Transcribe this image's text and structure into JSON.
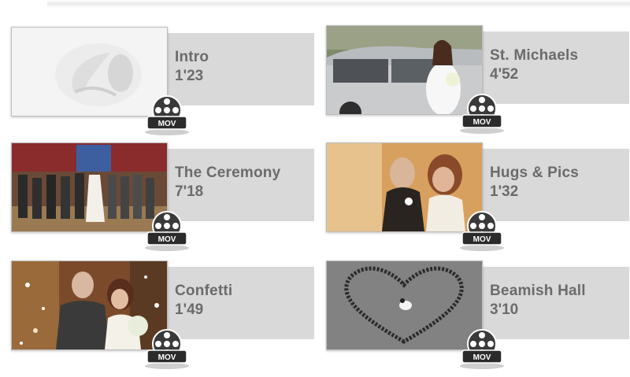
{
  "videos": [
    {
      "title": "Intro",
      "duration": "1'23",
      "format": "MOV"
    },
    {
      "title": "St. Michaels",
      "duration": "4'52",
      "format": "MOV"
    },
    {
      "title": "The Ceremony",
      "duration": "7'18",
      "format": "MOV"
    },
    {
      "title": "Hugs & Pics",
      "duration": "1'32",
      "format": "MOV"
    },
    {
      "title": "Confetti",
      "duration": "1'49",
      "format": "MOV"
    },
    {
      "title": "Beamish Hall",
      "duration": "3'10",
      "format": "MOV"
    }
  ],
  "icons": {
    "film_reel": "film-reel-icon"
  },
  "colors": {
    "band": "#d9d9d9",
    "text": "#6b6b6b",
    "mov_badge": "#2b2b2b"
  }
}
